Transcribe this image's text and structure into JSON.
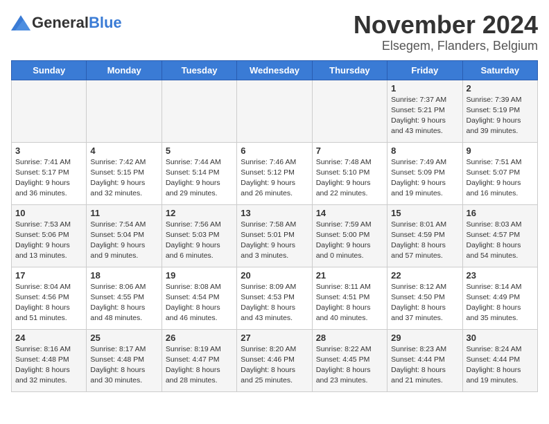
{
  "logo": {
    "general": "General",
    "blue": "Blue"
  },
  "title": "November 2024",
  "subtitle": "Elsegem, Flanders, Belgium",
  "days_header": [
    "Sunday",
    "Monday",
    "Tuesday",
    "Wednesday",
    "Thursday",
    "Friday",
    "Saturday"
  ],
  "weeks": [
    [
      {
        "day": "",
        "info": ""
      },
      {
        "day": "",
        "info": ""
      },
      {
        "day": "",
        "info": ""
      },
      {
        "day": "",
        "info": ""
      },
      {
        "day": "",
        "info": ""
      },
      {
        "day": "1",
        "info": "Sunrise: 7:37 AM\nSunset: 5:21 PM\nDaylight: 9 hours and 43 minutes."
      },
      {
        "day": "2",
        "info": "Sunrise: 7:39 AM\nSunset: 5:19 PM\nDaylight: 9 hours and 39 minutes."
      }
    ],
    [
      {
        "day": "3",
        "info": "Sunrise: 7:41 AM\nSunset: 5:17 PM\nDaylight: 9 hours and 36 minutes."
      },
      {
        "day": "4",
        "info": "Sunrise: 7:42 AM\nSunset: 5:15 PM\nDaylight: 9 hours and 32 minutes."
      },
      {
        "day": "5",
        "info": "Sunrise: 7:44 AM\nSunset: 5:14 PM\nDaylight: 9 hours and 29 minutes."
      },
      {
        "day": "6",
        "info": "Sunrise: 7:46 AM\nSunset: 5:12 PM\nDaylight: 9 hours and 26 minutes."
      },
      {
        "day": "7",
        "info": "Sunrise: 7:48 AM\nSunset: 5:10 PM\nDaylight: 9 hours and 22 minutes."
      },
      {
        "day": "8",
        "info": "Sunrise: 7:49 AM\nSunset: 5:09 PM\nDaylight: 9 hours and 19 minutes."
      },
      {
        "day": "9",
        "info": "Sunrise: 7:51 AM\nSunset: 5:07 PM\nDaylight: 9 hours and 16 minutes."
      }
    ],
    [
      {
        "day": "10",
        "info": "Sunrise: 7:53 AM\nSunset: 5:06 PM\nDaylight: 9 hours and 13 minutes."
      },
      {
        "day": "11",
        "info": "Sunrise: 7:54 AM\nSunset: 5:04 PM\nDaylight: 9 hours and 9 minutes."
      },
      {
        "day": "12",
        "info": "Sunrise: 7:56 AM\nSunset: 5:03 PM\nDaylight: 9 hours and 6 minutes."
      },
      {
        "day": "13",
        "info": "Sunrise: 7:58 AM\nSunset: 5:01 PM\nDaylight: 9 hours and 3 minutes."
      },
      {
        "day": "14",
        "info": "Sunrise: 7:59 AM\nSunset: 5:00 PM\nDaylight: 9 hours and 0 minutes."
      },
      {
        "day": "15",
        "info": "Sunrise: 8:01 AM\nSunset: 4:59 PM\nDaylight: 8 hours and 57 minutes."
      },
      {
        "day": "16",
        "info": "Sunrise: 8:03 AM\nSunset: 4:57 PM\nDaylight: 8 hours and 54 minutes."
      }
    ],
    [
      {
        "day": "17",
        "info": "Sunrise: 8:04 AM\nSunset: 4:56 PM\nDaylight: 8 hours and 51 minutes."
      },
      {
        "day": "18",
        "info": "Sunrise: 8:06 AM\nSunset: 4:55 PM\nDaylight: 8 hours and 48 minutes."
      },
      {
        "day": "19",
        "info": "Sunrise: 8:08 AM\nSunset: 4:54 PM\nDaylight: 8 hours and 46 minutes."
      },
      {
        "day": "20",
        "info": "Sunrise: 8:09 AM\nSunset: 4:53 PM\nDaylight: 8 hours and 43 minutes."
      },
      {
        "day": "21",
        "info": "Sunrise: 8:11 AM\nSunset: 4:51 PM\nDaylight: 8 hours and 40 minutes."
      },
      {
        "day": "22",
        "info": "Sunrise: 8:12 AM\nSunset: 4:50 PM\nDaylight: 8 hours and 37 minutes."
      },
      {
        "day": "23",
        "info": "Sunrise: 8:14 AM\nSunset: 4:49 PM\nDaylight: 8 hours and 35 minutes."
      }
    ],
    [
      {
        "day": "24",
        "info": "Sunrise: 8:16 AM\nSunset: 4:48 PM\nDaylight: 8 hours and 32 minutes."
      },
      {
        "day": "25",
        "info": "Sunrise: 8:17 AM\nSunset: 4:48 PM\nDaylight: 8 hours and 30 minutes."
      },
      {
        "day": "26",
        "info": "Sunrise: 8:19 AM\nSunset: 4:47 PM\nDaylight: 8 hours and 28 minutes."
      },
      {
        "day": "27",
        "info": "Sunrise: 8:20 AM\nSunset: 4:46 PM\nDaylight: 8 hours and 25 minutes."
      },
      {
        "day": "28",
        "info": "Sunrise: 8:22 AM\nSunset: 4:45 PM\nDaylight: 8 hours and 23 minutes."
      },
      {
        "day": "29",
        "info": "Sunrise: 8:23 AM\nSunset: 4:44 PM\nDaylight: 8 hours and 21 minutes."
      },
      {
        "day": "30",
        "info": "Sunrise: 8:24 AM\nSunset: 4:44 PM\nDaylight: 8 hours and 19 minutes."
      }
    ]
  ]
}
